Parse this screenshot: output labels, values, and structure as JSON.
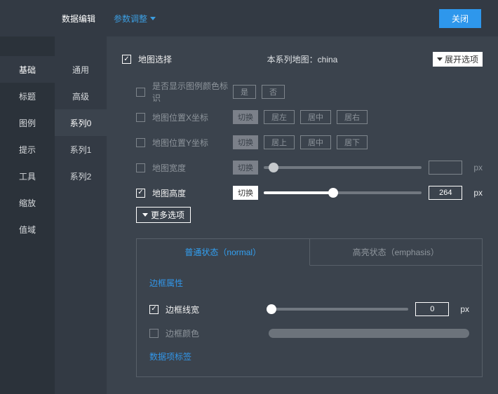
{
  "header": {
    "tab_data": "数据编辑",
    "tab_params": "参数调整",
    "close": "关闭"
  },
  "sidebar1": {
    "items": [
      "基础",
      "标题",
      "图例",
      "提示",
      "工具",
      "缩放",
      "值域"
    ],
    "active_index": 0
  },
  "sidebar2": {
    "items": [
      "通用",
      "高级",
      "系列0",
      "系列1",
      "系列2"
    ],
    "active_index": 2
  },
  "panel": {
    "map_select_label": "地图选择",
    "map_current_prefix": "本系列地图：",
    "map_current_value": "china",
    "expand_label": "展开选项",
    "more_label": "更多选项",
    "rows": {
      "legend_color": {
        "label": "是否显示图例颜色标识",
        "yes": "是",
        "no": "否"
      },
      "pos_x": {
        "label": "地图位置X坐标",
        "toggle": "切换",
        "opts": [
          "居左",
          "居中",
          "居右"
        ]
      },
      "pos_y": {
        "label": "地图位置Y坐标",
        "toggle": "切换",
        "opts": [
          "居上",
          "居中",
          "居下"
        ]
      },
      "map_width": {
        "label": "地图宽度",
        "toggle": "切换",
        "value": "",
        "unit": "px"
      },
      "map_height": {
        "label": "地图高度",
        "toggle": "切换",
        "value": "264",
        "unit": "px"
      }
    },
    "state": {
      "tab_normal": "普通状态（normal）",
      "tab_emphasis": "高亮状态（emphasis）",
      "border_section": "边框属性",
      "border_width_label": "边框线宽",
      "border_width_value": "0",
      "border_width_unit": "px",
      "border_color_label": "边框颜色",
      "data_label": "数据项标签"
    }
  }
}
